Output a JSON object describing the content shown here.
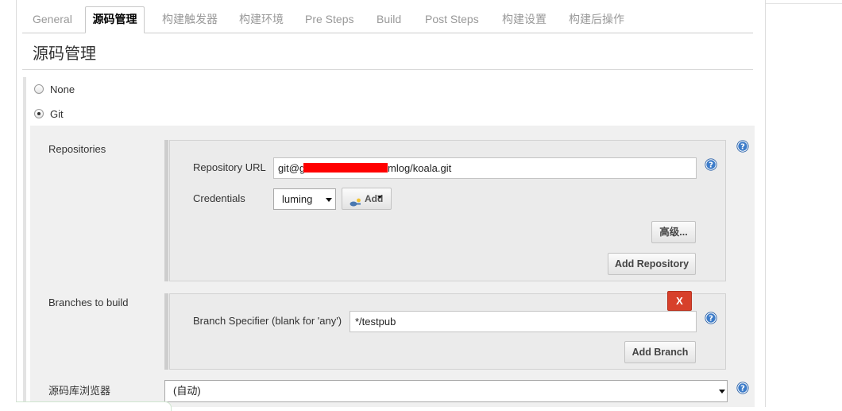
{
  "tabs": [
    {
      "label": "General",
      "active": false
    },
    {
      "label": "源码管理",
      "active": true
    },
    {
      "label": "构建触发器",
      "active": false
    },
    {
      "label": "构建环境",
      "active": false
    },
    {
      "label": "Pre Steps",
      "active": false
    },
    {
      "label": "Build",
      "active": false
    },
    {
      "label": "Post Steps",
      "active": false
    },
    {
      "label": "构建设置",
      "active": false
    },
    {
      "label": "构建后操作",
      "active": false
    }
  ],
  "section": {
    "title": "源码管理"
  },
  "scm_options": [
    {
      "label": "None",
      "checked": false
    },
    {
      "label": "Git",
      "checked": true
    }
  ],
  "git": {
    "repositories": {
      "label": "Repositories",
      "url_label": "Repository URL",
      "url_value_prefix": "git@g",
      "url_value_suffix": "mlog/koala.git",
      "credentials_label": "Credentials",
      "credentials_value": "luming",
      "add_credentials_label": "Add",
      "advanced_label": "高级...",
      "add_repository_label": "Add Repository"
    },
    "branches": {
      "label": "Branches to build",
      "delete_label": "X",
      "specifier_label": "Branch Specifier (blank for 'any')",
      "specifier_value": "*/testpub",
      "add_branch_label": "Add Branch"
    },
    "repository_browser": {
      "label": "源码库浏览器",
      "value": "(自动)"
    }
  },
  "icons": {
    "help": "help-icon",
    "credentials_add": "key-icon",
    "select_arrow": "chevron-down-icon",
    "add_menu_arrow": "dropdown-triangle-icon"
  },
  "colors": {
    "delete_button": "#d7402b",
    "help_icon": "#2b62a8",
    "redaction_mask": "#ff0000",
    "inactive_tab_text": "#999999",
    "section_background": "#f0f0f0"
  }
}
